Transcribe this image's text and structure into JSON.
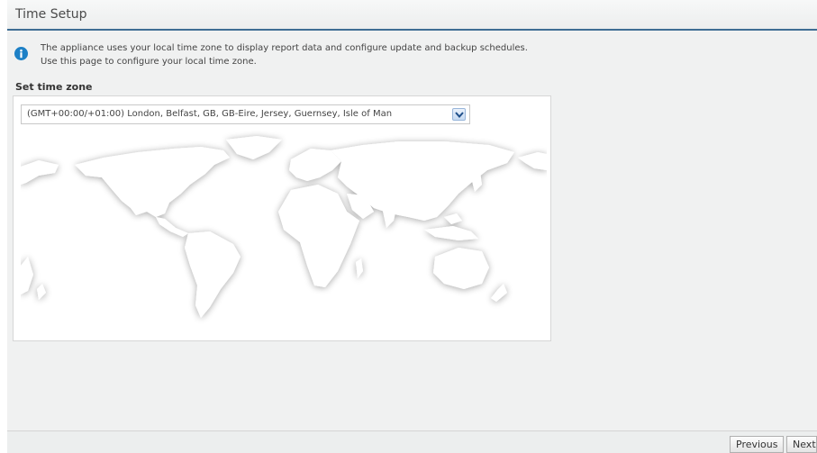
{
  "page": {
    "title": "Time Setup"
  },
  "info": {
    "icon": "info-icon",
    "line1": "The appliance uses your local time zone to display report data and configure update and backup schedules.",
    "line2": "Use this page to configure your local time zone."
  },
  "timezone": {
    "label": "Set time zone",
    "selected": "(GMT+00:00/+01:00) London, Belfast, GB, GB-Eire, Jersey, Guernsey, Isle of Man"
  },
  "footer": {
    "previous_label": "Previous",
    "next_label": "Next"
  },
  "colors": {
    "accent": "#3e6d93",
    "info": "#1d80c6"
  }
}
